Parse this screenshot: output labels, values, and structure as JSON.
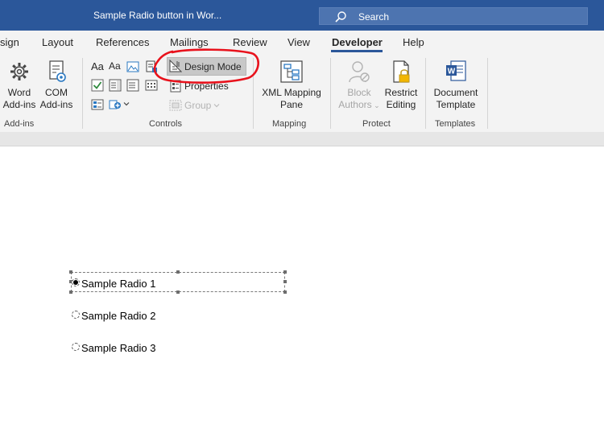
{
  "window": {
    "title": "Sample Radio button in Wor..."
  },
  "search": {
    "label": "Search"
  },
  "tabs": [
    {
      "label": "sign"
    },
    {
      "label": "Layout"
    },
    {
      "label": "References"
    },
    {
      "label": "Mailings"
    },
    {
      "label": "Review"
    },
    {
      "label": "View"
    },
    {
      "label": "Developer"
    },
    {
      "label": "Help"
    }
  ],
  "ribbon": {
    "addins": {
      "word_line1": "Word",
      "word_line2": "Add-ins",
      "com_line1": "COM",
      "com_line2": "Add-ins",
      "group": "Add-ins"
    },
    "controls": {
      "design_mode": "Design Mode",
      "properties": "Properties",
      "group_btn": "Group",
      "group": "Controls",
      "aa1": "Aa",
      "aa2": "Aa"
    },
    "mapping": {
      "xml_line1": "XML Mapping",
      "xml_line2": "Pane",
      "group": "Mapping"
    },
    "protect": {
      "block_line1": "Block",
      "block_line2": "Authors",
      "restrict_line1": "Restrict",
      "restrict_line2": "Editing",
      "group": "Protect"
    },
    "templates": {
      "doc_line1": "Document",
      "doc_line2": "Template",
      "group": "Templates"
    }
  },
  "document": {
    "radios": [
      {
        "label": "Sample Radio 1",
        "selected": true
      },
      {
        "label": "Sample Radio 2",
        "selected": false
      },
      {
        "label": "Sample Radio 3",
        "selected": false
      }
    ]
  },
  "colors": {
    "title_bar": "#2b579a",
    "annotation": "#e8121c"
  }
}
